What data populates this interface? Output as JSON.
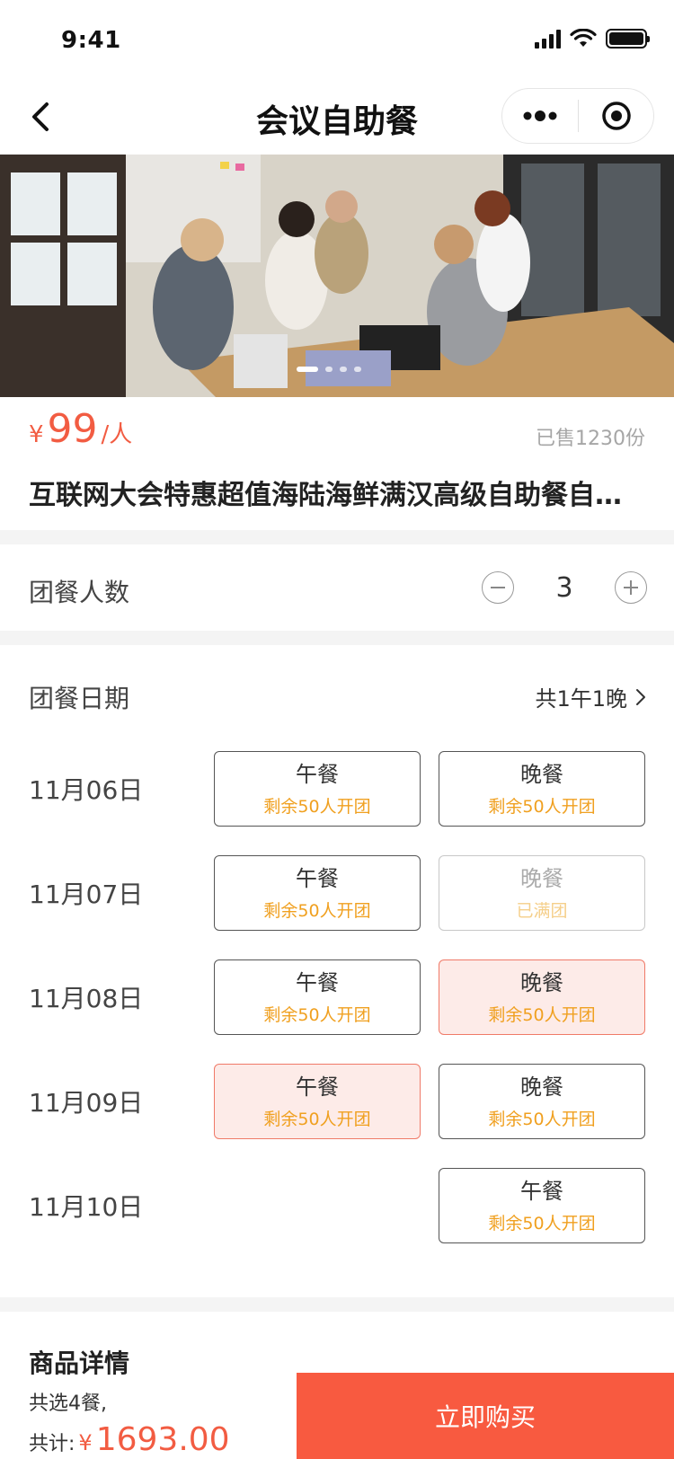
{
  "status_bar": {
    "time": "9:41"
  },
  "nav": {
    "title": "会议自助餐"
  },
  "banner": {
    "active_index": 0,
    "dot_count": 4
  },
  "product": {
    "currency": "¥",
    "price": "99",
    "unit": "/人",
    "sold": "已售1230份",
    "title": "互联网大会特惠超值海陆海鲜满汉高级自助餐自助餐"
  },
  "group_count": {
    "label": "团餐人数",
    "value": "3"
  },
  "group_date": {
    "label": "团餐日期",
    "summary": "共1午1晚"
  },
  "dates": [
    {
      "date": "11月06日",
      "lunch": {
        "name": "午餐",
        "status": "剩余50人开团",
        "state": "normal"
      },
      "dinner": {
        "name": "晚餐",
        "status": "剩余50人开团",
        "state": "normal"
      }
    },
    {
      "date": "11月07日",
      "lunch": {
        "name": "午餐",
        "status": "剩余50人开团",
        "state": "normal"
      },
      "dinner": {
        "name": "晚餐",
        "status": "已满团",
        "state": "disabled"
      }
    },
    {
      "date": "11月08日",
      "lunch": {
        "name": "午餐",
        "status": "剩余50人开团",
        "state": "normal"
      },
      "dinner": {
        "name": "晚餐",
        "status": "剩余50人开团",
        "state": "selected"
      }
    },
    {
      "date": "11月09日",
      "lunch": {
        "name": "午餐",
        "status": "剩余50人开团",
        "state": "selected"
      },
      "dinner": {
        "name": "晚餐",
        "status": "剩余50人开团",
        "state": "normal"
      }
    },
    {
      "date": "11月10日",
      "dinner": {
        "name": "午餐",
        "status": "剩余50人开团",
        "state": "normal"
      }
    }
  ],
  "details": {
    "title": "商品详情"
  },
  "footer": {
    "selected_count": "共选4餐,",
    "total_label": "共计:",
    "currency": "¥",
    "total": "1693.00",
    "buy_label": "立即购买"
  },
  "colors": {
    "accent": "#f85a40",
    "status_orange": "#f0a020",
    "selected_bg": "#fdebe8"
  }
}
